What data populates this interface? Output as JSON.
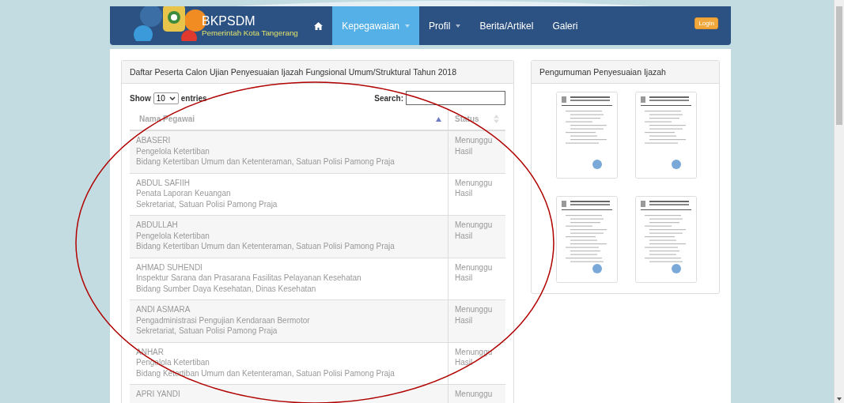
{
  "brand": {
    "title": "BKPSDM",
    "subtitle": "Pemerintah Kota Tangerang"
  },
  "nav": [
    {
      "kind": "home",
      "selected": false
    },
    {
      "kind": "text",
      "label": "Kepegawaian",
      "selected": true,
      "caret": true
    },
    {
      "kind": "text",
      "label": "Profil",
      "selected": false,
      "caret": true
    },
    {
      "kind": "text",
      "label": "Berita/Artikel",
      "selected": false,
      "caret": false
    },
    {
      "kind": "text",
      "label": "Galeri",
      "selected": false,
      "caret": false
    }
  ],
  "login_button": "Login",
  "table_panel": {
    "title": "Daftar Peserta Calon Ujian Penyesuaian Ijazah Fungsional Umum/Struktural Tahun 2018",
    "show_label": "Show",
    "entries_value": "10",
    "entries_label": "entries",
    "search_label": "Search:",
    "columns": [
      {
        "label": "Nama Pegawai",
        "sorted": true
      },
      {
        "label": "Status",
        "sorted": false
      }
    ],
    "rows": [
      {
        "name": "ABASERI",
        "position": "Pengelola Ketertiban",
        "unit": "Bidang Ketertiban Umum dan Ketenteraman, Satuan Polisi Pamong Praja",
        "status": "Menunggu Hasil"
      },
      {
        "name": "ABDUL SAFIIH",
        "position": "Penata Laporan Keuangan",
        "unit": "Sekretariat, Satuan Polisi Pamong Praja",
        "status": "Menunggu Hasil"
      },
      {
        "name": "ABDULLAH",
        "position": "Pengelola Ketertiban",
        "unit": "Bidang Ketertiban Umum dan Ketenteraman, Satuan Polisi Pamong Praja",
        "status": "Menunggu Hasil"
      },
      {
        "name": "AHMAD SUHENDI",
        "position": "Inspektur Sarana dan Prasarana Fasilitas Pelayanan Kesehatan",
        "unit": "Bidang Sumber Daya Kesehatan, Dinas Kesehatan",
        "status": "Menunggu Hasil"
      },
      {
        "name": "ANDI ASMARA",
        "position": "Pengadministrasi Pengujian Kendaraan Bermotor",
        "unit": "Sekretariat, Satuan Polisi Pamong Praja",
        "status": "Menunggu Hasil"
      },
      {
        "name": "ANHAR",
        "position": "Pengelola Ketertiban",
        "unit": "Bidang Ketertiban Umum dan Ketenteraman, Satuan Polisi Pamong Praja",
        "status": "Menunggu Hasil"
      },
      {
        "name": "APRI YANDI",
        "status": "Menunggu"
      }
    ]
  },
  "announcement_panel": {
    "title": "Pengumuman Penyesuaian Ijazah",
    "documents": [
      {
        "kind": "letter"
      },
      {
        "kind": "letter"
      },
      {
        "kind": "decree"
      },
      {
        "kind": "decree"
      }
    ]
  }
}
